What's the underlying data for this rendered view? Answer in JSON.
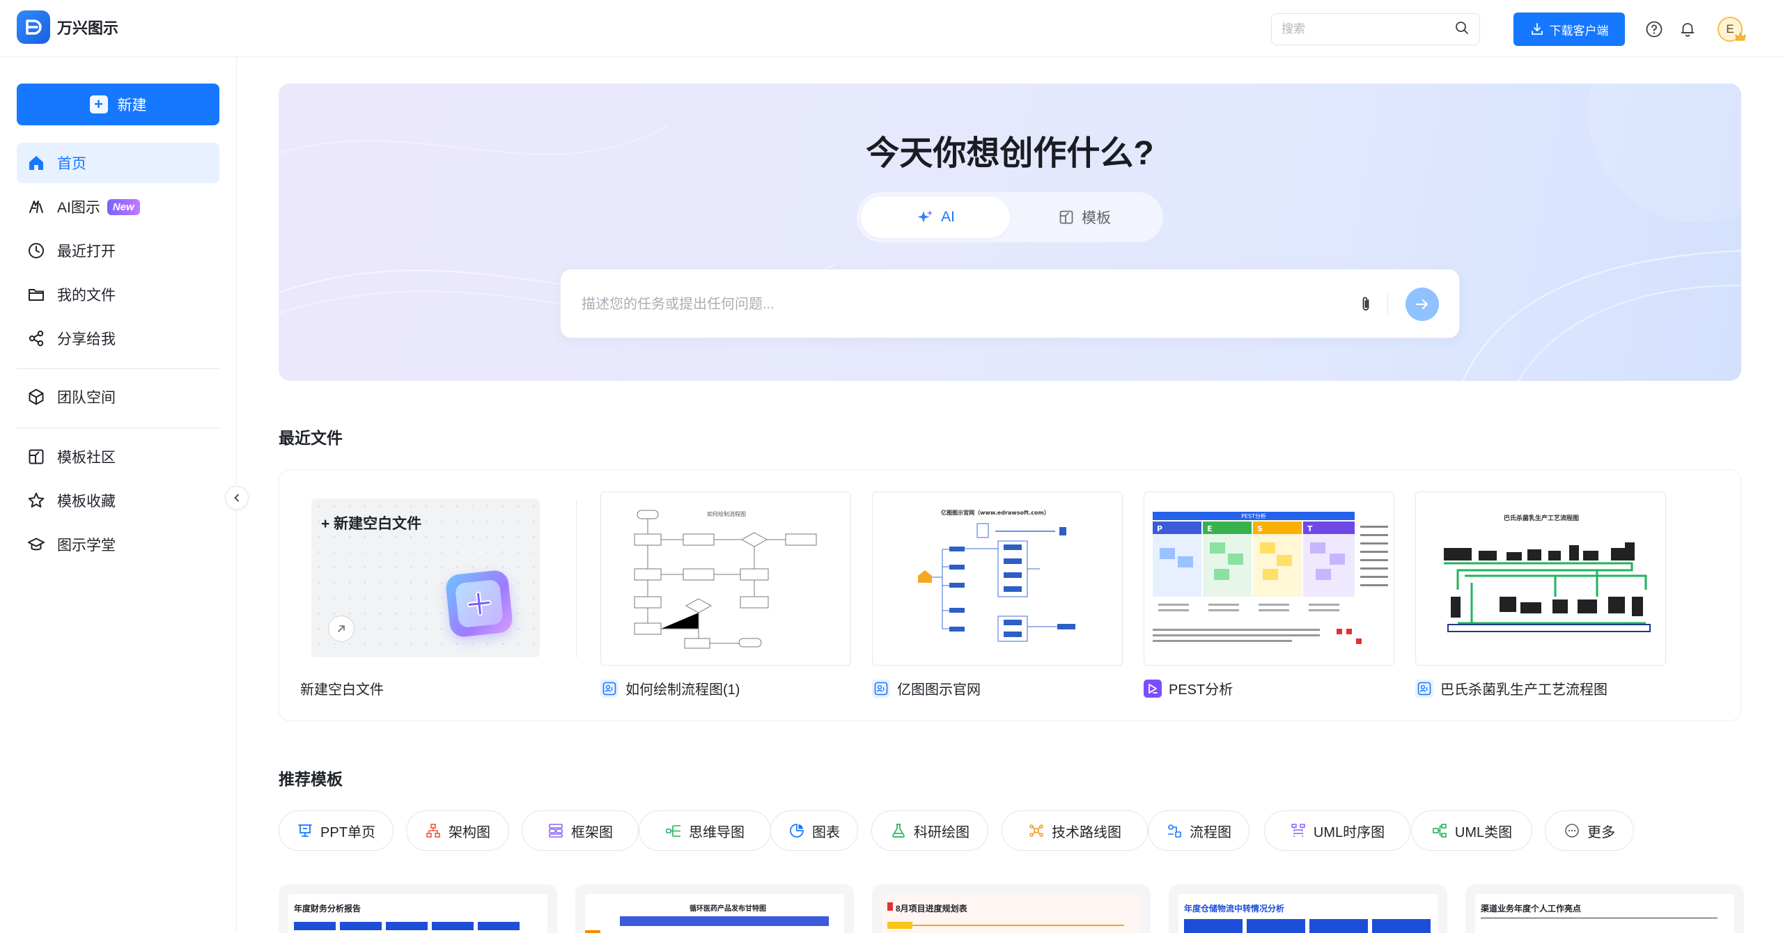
{
  "app": {
    "name": "万兴图示"
  },
  "header": {
    "search_placeholder": "搜索",
    "download_label": "下载客户端",
    "avatar_letter": "E"
  },
  "sidebar": {
    "new_label": "新建",
    "items": [
      {
        "label": "首页",
        "icon": "home-icon",
        "active": true
      },
      {
        "label": "AI图示",
        "icon": "ai-icon",
        "badge": "New"
      },
      {
        "label": "最近打开",
        "icon": "clock-icon"
      },
      {
        "label": "我的文件",
        "icon": "folder-icon"
      },
      {
        "label": "分享给我",
        "icon": "share-icon"
      },
      {
        "label": "团队空间",
        "icon": "cube-icon"
      },
      {
        "label": "模板社区",
        "icon": "template-icon"
      },
      {
        "label": "模板收藏",
        "icon": "star-icon"
      },
      {
        "label": "图示学堂",
        "icon": "graduation-cap-icon"
      }
    ]
  },
  "hero": {
    "title": "今天你想创作什么?",
    "tabs": [
      {
        "label": "AI",
        "icon": "sparkle-icon",
        "active": true
      },
      {
        "label": "模板",
        "icon": "template-icon",
        "active": false
      }
    ],
    "prompt_placeholder": "描述您的任务或提出任何问题..."
  },
  "recent": {
    "title": "最近文件",
    "blank_title": "+ 新建空白文件",
    "blank_label": "新建空白文件",
    "files": [
      {
        "name": "如何绘制流程图(1)",
        "icon": "team-file-icon",
        "thumb_title": "如何绘制流程图"
      },
      {
        "name": "亿图图示官网",
        "icon": "team-file-icon",
        "thumb_title": "亿图图示官网（www.edrawsoft.com）"
      },
      {
        "name": "PEST分析",
        "icon": "slides-file-icon",
        "thumb_title": "PEST分析"
      },
      {
        "name": "巴氏杀菌乳生产工艺流程图",
        "icon": "team-file-icon",
        "thumb_title": "巴氏杀菌乳生产工艺流程图"
      }
    ]
  },
  "templates": {
    "title": "推荐模板",
    "chips": [
      {
        "label": "PPT单页",
        "icon": "presentation-icon",
        "color": "#1677ff"
      },
      {
        "label": "架构图",
        "icon": "org-chart-icon",
        "color": "#f5553b"
      },
      {
        "label": "框架图",
        "icon": "framework-icon",
        "color": "#8a63f6"
      },
      {
        "label": "思维导图",
        "icon": "mindmap-icon",
        "color": "#22b35e"
      },
      {
        "label": "图表",
        "icon": "pie-chart-icon",
        "color": "#1677ff"
      },
      {
        "label": "科研绘图",
        "icon": "flask-icon",
        "color": "#22b35e"
      },
      {
        "label": "技术路线图",
        "icon": "roadmap-icon",
        "color": "#f59a23"
      },
      {
        "label": "流程图",
        "icon": "flowchart-icon",
        "color": "#1677ff"
      },
      {
        "label": "UML时序图",
        "icon": "uml-sequence-icon",
        "color": "#8a63f6"
      },
      {
        "label": "UML类图",
        "icon": "uml-class-icon",
        "color": "#22b35e"
      },
      {
        "label": "更多",
        "icon": "more-icon",
        "color": "#5f6368"
      }
    ],
    "previews": [
      {
        "title": "年度财务分析报告"
      },
      {
        "title": "循环医药产品发布甘特图"
      },
      {
        "title": "8月项目进度规划表"
      },
      {
        "title": "年度仓储物流中转情况分析"
      },
      {
        "title": "渠道业务年度个人工作亮点"
      }
    ]
  },
  "colors": {
    "primary": "#1677ff",
    "hero_start": "#ece8fc",
    "hero_end": "#d4e1fd"
  }
}
